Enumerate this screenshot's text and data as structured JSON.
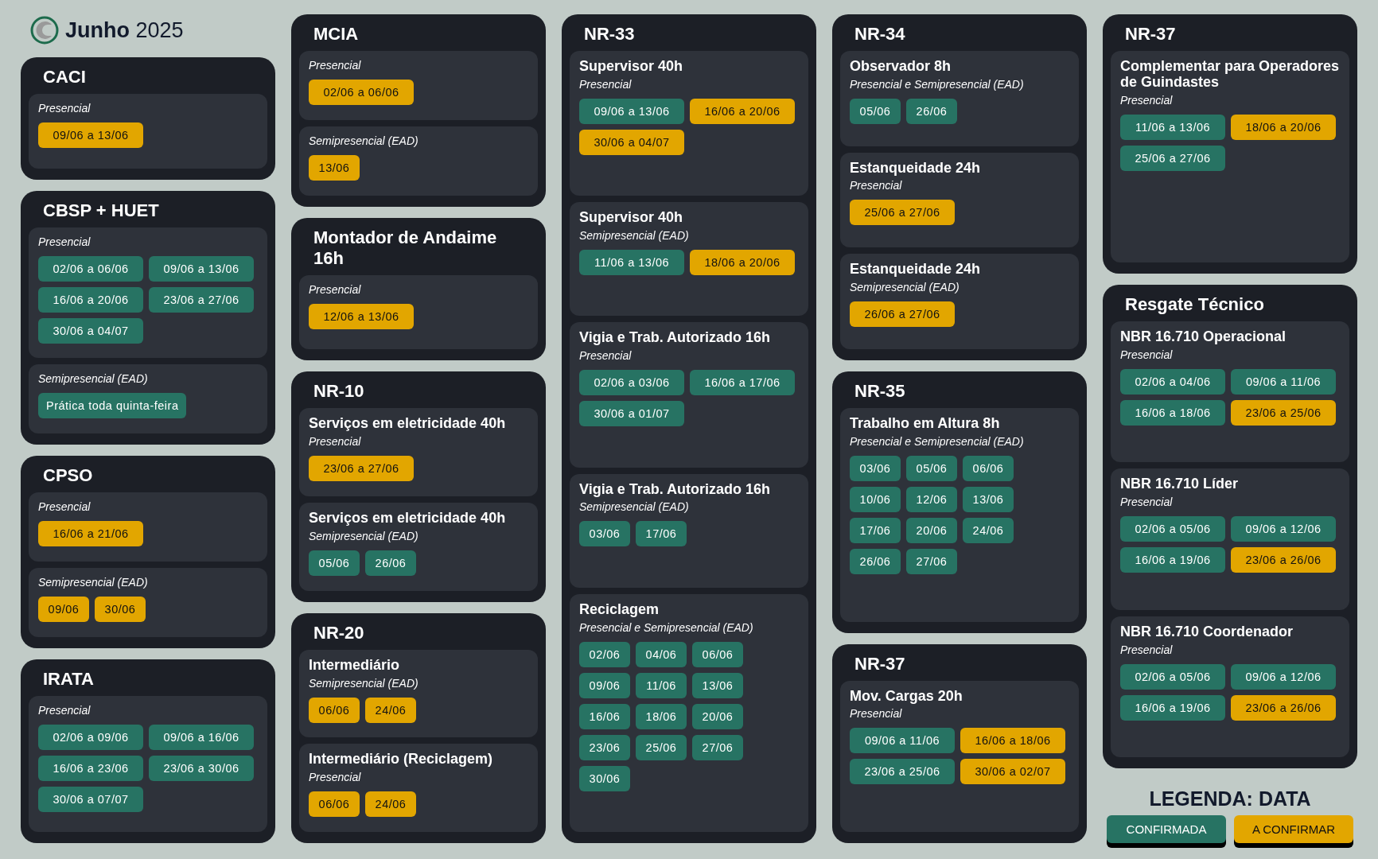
{
  "header": {
    "title": "**Junho** 2025"
  },
  "columns": [
    {
      "cards": [
        {
          "title": "CACI",
          "sections": [
            {
              "mode": "Presencial",
              "dates": [
                {
                  "text": "09/06 a 13/06",
                  "color": "#e2a600"
                }
              ]
            }
          ]
        },
        {
          "title": "CBSP + HUET",
          "sections": [
            {
              "mode": "Presencial",
              "dates": [
                {
                  "text": "02/06 a 06/06",
                  "color": "#277363"
                },
                {
                  "text": "09/06 a 13/06",
                  "color": "#277363"
                },
                {
                  "text": "16/06 a 20/06",
                  "color": "#277363"
                },
                {
                  "text": "23/06 a 27/06",
                  "color": "#277363"
                },
                {
                  "text": "30/06 a 04/07",
                  "color": "#277363"
                }
              ]
            },
            {
              "mode": "Semipresencial (EAD)",
              "dates": [
                {
                  "text": "Prática toda quinta-feira",
                  "color": "#277363"
                }
              ]
            }
          ]
        },
        {
          "title": "CPSO",
          "sections": [
            {
              "mode": "Presencial",
              "dates": [
                {
                  "text": "16/06 a 21/06",
                  "color": "#e2a600"
                }
              ]
            },
            {
              "mode": "Semipresencial (EAD)",
              "dates": [
                {
                  "text": "09/06",
                  "color": "#e2a600"
                },
                {
                  "text": "30/06",
                  "color": "#e2a600"
                }
              ]
            }
          ]
        },
        {
          "title": "IRATA",
          "sections": [
            {
              "mode": "Presencial",
              "dates": [
                {
                  "text": "02/06 a 09/06",
                  "color": "#277363"
                },
                {
                  "text": "09/06 a 16/06",
                  "color": "#277363"
                },
                {
                  "text": "16/06 a 23/06",
                  "color": "#277363"
                },
                {
                  "text": "23/06 a 30/06",
                  "color": "#277363"
                },
                {
                  "text": "30/06 a 07/07",
                  "color": "#277363"
                }
              ]
            }
          ]
        }
      ]
    },
    {
      "cards": [
        {
          "title": "MCIA",
          "sections": [
            {
              "mode": "Presencial",
              "dates": [
                {
                  "text": "02/06 a 06/06",
                  "color": "#e2a600"
                }
              ]
            },
            {
              "mode": "Semipresencial (EAD)",
              "dates": [
                {
                  "text": "13/06",
                  "color": "#e2a600"
                }
              ]
            }
          ]
        },
        {
          "title": "Montador de Andaime 16h",
          "sections": [
            {
              "mode": "Presencial",
              "dates": [
                {
                  "text": "12/06 a 13/06",
                  "color": "#e2a600"
                }
              ]
            }
          ]
        },
        {
          "title": "NR-10",
          "sections": [
            {
              "name": "Serviços em eletricidade 40h",
              "mode": "Presencial",
              "dates": [
                {
                  "text": "23/06 a 27/06",
                  "color": "#e2a600"
                }
              ]
            },
            {
              "name": "Serviços em eletricidade 40h",
              "mode": "Semipresencial (EAD)",
              "dates": [
                {
                  "text": "05/06",
                  "color": "#277363"
                },
                {
                  "text": "26/06",
                  "color": "#277363"
                }
              ]
            }
          ]
        },
        {
          "title": "NR-20",
          "sections": [
            {
              "name": "Intermediário",
              "mode": "Semipresencial (EAD)",
              "dates": [
                {
                  "text": "06/06",
                  "color": "#e2a600"
                },
                {
                  "text": "24/06",
                  "color": "#e2a600"
                }
              ]
            },
            {
              "name": "Intermediário (Reciclagem)",
              "mode": "Presencial",
              "dates": [
                {
                  "text": "06/06",
                  "color": "#e2a600"
                },
                {
                  "text": "24/06",
                  "color": "#e2a600"
                }
              ]
            }
          ]
        }
      ]
    },
    {
      "cards": [
        {
          "title": "NR-33",
          "sections": [
            {
              "name": "Supervisor 40h",
              "mode": "Presencial",
              "dates": [
                {
                  "text": "09/06 a 13/06",
                  "color": "#277363"
                },
                {
                  "text": "16/06 a 20/06",
                  "color": "#e2a600"
                },
                {
                  "text": "30/06 a 04/07",
                  "color": "#e2a600"
                }
              ]
            },
            {
              "name": "Supervisor 40h",
              "mode": "Semipresencial (EAD)",
              "dates": [
                {
                  "text": "11/06 a 13/06",
                  "color": "#277363"
                },
                {
                  "text": "18/06 a 20/06",
                  "color": "#e2a600"
                }
              ]
            },
            {
              "name": "Vigia e Trab. Autorizado 16h",
              "mode": "Presencial",
              "dates": [
                {
                  "text": "02/06 a 03/06",
                  "color": "#277363"
                },
                {
                  "text": "16/06 a 17/06",
                  "color": "#277363"
                },
                {
                  "text": "30/06 a 01/07",
                  "color": "#277363"
                }
              ]
            },
            {
              "name": "Vigia e Trab. Autorizado 16h",
              "mode": "Semipresencial (EAD)",
              "dates": [
                {
                  "text": "03/06",
                  "color": "#277363"
                },
                {
                  "text": "17/06",
                  "color": "#277363"
                }
              ]
            },
            {
              "name": "Reciclagem",
              "mode": "Presencial e Semipresencial (EAD)",
              "dates": [
                {
                  "text": "02/06",
                  "color": "#277363"
                },
                {
                  "text": "04/06",
                  "color": "#277363"
                },
                {
                  "text": "06/06",
                  "color": "#277363"
                },
                {
                  "text": "09/06",
                  "color": "#277363"
                },
                {
                  "text": "11/06",
                  "color": "#277363"
                },
                {
                  "text": "13/06",
                  "color": "#277363"
                },
                {
                  "text": "16/06",
                  "color": "#277363"
                },
                {
                  "text": "18/06",
                  "color": "#277363"
                },
                {
                  "text": "20/06",
                  "color": "#277363"
                },
                {
                  "text": "23/06",
                  "color": "#277363"
                },
                {
                  "text": "25/06",
                  "color": "#277363"
                },
                {
                  "text": "27/06",
                  "color": "#277363"
                },
                {
                  "text": "30/06",
                  "color": "#277363"
                }
              ]
            }
          ]
        }
      ]
    },
    {
      "cards": [
        {
          "title": "NR-34",
          "sections": [
            {
              "name": "Observador 8h",
              "mode": "Presencial e Semipresencial (EAD)",
              "dates": [
                {
                  "text": "05/06",
                  "color": "#277363"
                },
                {
                  "text": "26/06",
                  "color": "#277363"
                }
              ]
            },
            {
              "name": "Estanqueidade 24h",
              "mode": "Presencial",
              "dates": [
                {
                  "text": "25/06 a 27/06",
                  "color": "#e2a600"
                }
              ]
            },
            {
              "name": "Estanqueidade 24h",
              "mode": "Semipresencial (EAD)",
              "dates": [
                {
                  "text": "26/06 a 27/06",
                  "color": "#e2a600"
                }
              ]
            }
          ]
        },
        {
          "title": "NR-35",
          "sections": [
            {
              "name": "Trabalho em Altura 8h",
              "mode": "Presencial e Semipresencial (EAD)",
              "dates": [
                {
                  "text": "03/06",
                  "color": "#277363"
                },
                {
                  "text": "05/06",
                  "color": "#277363"
                },
                {
                  "text": "06/06",
                  "color": "#277363"
                },
                {
                  "text": "10/06",
                  "color": "#277363"
                },
                {
                  "text": "12/06",
                  "color": "#277363"
                },
                {
                  "text": "13/06",
                  "color": "#277363"
                },
                {
                  "text": "17/06",
                  "color": "#277363"
                },
                {
                  "text": "20/06",
                  "color": "#277363"
                },
                {
                  "text": "24/06",
                  "color": "#277363"
                },
                {
                  "text": "26/06",
                  "color": "#277363"
                },
                {
                  "text": "27/06",
                  "color": "#277363"
                }
              ]
            }
          ]
        },
        {
          "title": "NR-37",
          "sections": [
            {
              "name": "Mov. Cargas 20h",
              "mode": "Presencial",
              "dates": [
                {
                  "text": "09/06 a 11/06",
                  "color": "#277363"
                },
                {
                  "text": "16/06 a 18/06",
                  "color": "#e2a600"
                },
                {
                  "text": "23/06 a 25/06",
                  "color": "#277363"
                },
                {
                  "text": "30/06 a 02/07",
                  "color": "#e2a600"
                }
              ]
            }
          ]
        }
      ]
    },
    {
      "cards": [
        {
          "title": "NR-37",
          "sections": [
            {
              "name": "Complementar para Operadores de Guindastes",
              "mode": "Presencial",
              "dates": [
                {
                  "text": "11/06 a 13/06",
                  "color": "#277363"
                },
                {
                  "text": "18/06 a 20/06",
                  "color": "#e2a600"
                },
                {
                  "text": "25/06 a 27/06",
                  "color": "#277363"
                }
              ]
            }
          ]
        },
        {
          "title": "Resgate Técnico",
          "sections": [
            {
              "name": "NBR 16.710 Operacional",
              "mode": "Presencial",
              "dates": [
                {
                  "text": "02/06 a 04/06",
                  "color": "#277363"
                },
                {
                  "text": "09/06 a 11/06",
                  "color": "#277363"
                },
                {
                  "text": "16/06 a 18/06",
                  "color": "#277363"
                },
                {
                  "text": "23/06 a 25/06",
                  "color": "#e2a600"
                }
              ]
            },
            {
              "name": "NBR 16.710 Líder",
              "mode": "Presencial",
              "dates": [
                {
                  "text": "02/06 a 05/06",
                  "color": "#277363"
                },
                {
                  "text": "09/06 a 12/06",
                  "color": "#277363"
                },
                {
                  "text": "16/06 a 19/06",
                  "color": "#277363"
                },
                {
                  "text": "23/06 a 26/06",
                  "color": "#e2a600"
                }
              ]
            },
            {
              "name": "NBR 16.710 Coordenador",
              "mode": "Presencial",
              "dates": [
                {
                  "text": "02/06 a 05/06",
                  "color": "#277363"
                },
                {
                  "text": "09/06 a 12/06",
                  "color": "#277363"
                },
                {
                  "text": "16/06 a 19/06",
                  "color": "#277363"
                },
                {
                  "text": "23/06 a 26/06",
                  "color": "#e2a600"
                }
              ]
            }
          ]
        }
      ]
    }
  ],
  "legend": {
    "title": "LEGENDA: DATA",
    "items": [
      {
        "label": "CONFIRMADA",
        "color": "#277363"
      },
      {
        "label": "A CONFIRMAR",
        "color": "#e2a600"
      }
    ]
  }
}
